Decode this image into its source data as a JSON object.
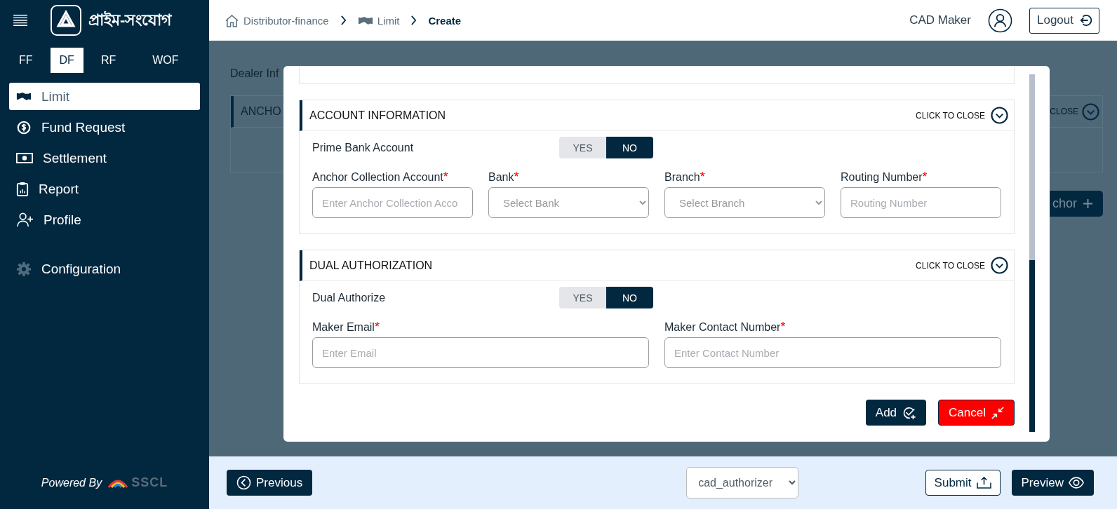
{
  "sidebar": {
    "logo_text": "প্রাইম-সংযোগ",
    "modules": [
      {
        "label": "FF",
        "selected": false
      },
      {
        "label": "DF",
        "selected": true
      },
      {
        "label": "RF",
        "selected": false
      },
      {
        "label": "WOF",
        "selected": false
      }
    ],
    "nav": [
      {
        "label": "Limit",
        "selected": true
      },
      {
        "label": "Fund Request",
        "selected": false
      },
      {
        "label": "Settlement",
        "selected": false
      },
      {
        "label": "Report",
        "selected": false
      },
      {
        "label": "Profile",
        "selected": false
      },
      {
        "label": "Configuration",
        "selected": false
      }
    ],
    "powered_by": "Powered By",
    "brand": "SSCL"
  },
  "header": {
    "breadcrumbs": [
      {
        "label": "Distributor-finance",
        "current": false
      },
      {
        "label": "Limit",
        "current": false
      },
      {
        "label": "Create",
        "current": true
      }
    ],
    "user": "CAD Maker",
    "logout": "Logout"
  },
  "background": {
    "section_title": "Dealer Inf",
    "card_title": "ANCHO",
    "close_hint": "CLOSE",
    "add_button": "chor"
  },
  "modal": {
    "sections": [
      {
        "title": "ACCOUNT INFORMATION",
        "hint": "CLICK TO CLOSE",
        "toggle": {
          "label": "Prime Bank Account",
          "options": [
            {
              "label": "YES",
              "selected": false
            },
            {
              "label": "NO",
              "selected": true
            }
          ]
        },
        "fields": [
          {
            "label": "Anchor Collection Account",
            "mark": "*",
            "kind": "input",
            "placeholder": "Enter Anchor Collection Acco"
          },
          {
            "label": "Bank",
            "mark": "*",
            "kind": "select",
            "placeholder": "Select Bank"
          },
          {
            "label": "Branch",
            "mark": "*",
            "kind": "select",
            "placeholder": "Select Branch"
          },
          {
            "label": "Routing Number",
            "mark": "*",
            "kind": "input",
            "placeholder": "Routing Number"
          }
        ]
      },
      {
        "title": "DUAL AUTHORIZATION",
        "hint": "CLICK TO CLOSE",
        "toggle": {
          "label": "Dual Authorize",
          "options": [
            {
              "label": "YES",
              "selected": false
            },
            {
              "label": "NO",
              "selected": true
            }
          ]
        },
        "fields": [
          {
            "label": "Maker Email",
            "mark": "*",
            "kind": "input",
            "placeholder": "Enter Email"
          },
          {
            "label": "Maker Contact Number",
            "mark": "*",
            "kind": "input",
            "placeholder": "Enter Contact Number"
          }
        ]
      }
    ],
    "add": "Add",
    "cancel": "Cancel"
  },
  "footer": {
    "previous": "Previous",
    "select_value": "cad_authorizer",
    "submit": "Submit",
    "preview": "Preview"
  }
}
